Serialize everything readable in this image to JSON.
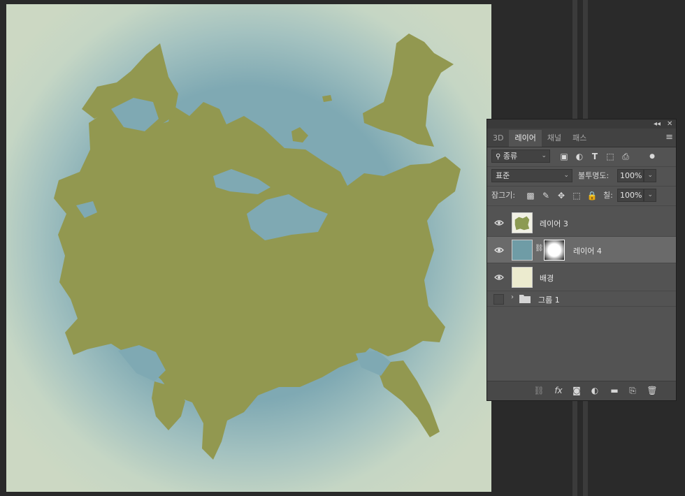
{
  "panel": {
    "controls": {
      "collapse": "◂◂",
      "close": "✕"
    },
    "tabs": [
      {
        "label": "3D",
        "active": false
      },
      {
        "label": "레이어",
        "active": true
      },
      {
        "label": "채널",
        "active": false
      },
      {
        "label": "패스",
        "active": false
      }
    ],
    "filter": {
      "kind_label": "종류"
    },
    "blend": {
      "mode": "표준",
      "opacity_label": "불투명도:",
      "opacity_value": "100%"
    },
    "lock": {
      "label": "잠그기:",
      "fill_label": "칠:",
      "fill_value": "100%"
    },
    "layers": [
      {
        "name": "레이어 3",
        "visible": true,
        "selected": false,
        "thumb": "map"
      },
      {
        "name": "레이어 4",
        "visible": true,
        "selected": true,
        "thumb": "blue",
        "has_mask": true
      },
      {
        "name": "배경",
        "visible": true,
        "selected": false,
        "thumb": "cream"
      },
      {
        "name": "그룹 1",
        "visible": false,
        "selected": false,
        "thumb": "folder"
      }
    ]
  },
  "colors": {
    "land": "#929850",
    "water": "#7fa9b3",
    "edge": "#ccd8c3",
    "layer4_fill": "#6f9ca6",
    "background_fill": "#ecebcf"
  }
}
